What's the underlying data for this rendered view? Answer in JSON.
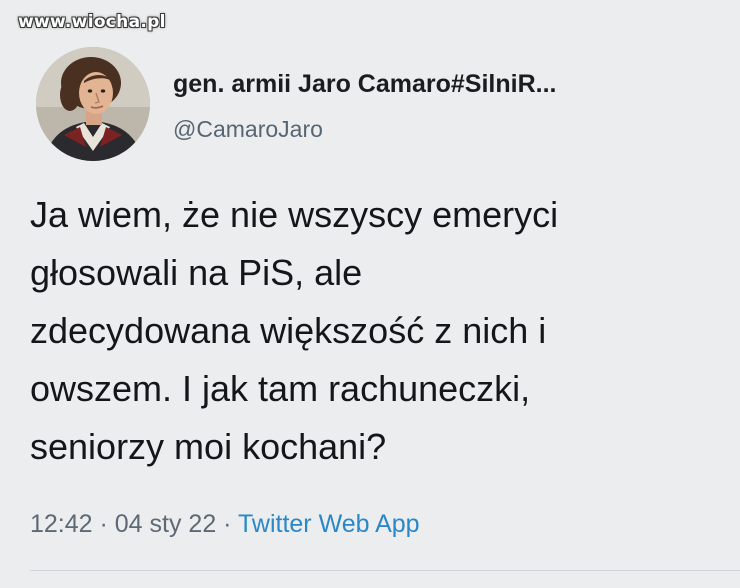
{
  "watermark": "www.wiocha.pl",
  "author": {
    "name": "gen. armii Jaro Camaro#SilniR...",
    "handle": "@CamaroJaro",
    "avatar": "avatar-portrait"
  },
  "tweet": {
    "lines": [
      "Ja wiem, że nie wszyscy emeryci",
      "głosowali na PiS, ale",
      "zdecydowana większość z nich i",
      "owszem. I jak tam rachuneczki,",
      "seniorzy moi kochani?"
    ]
  },
  "meta": {
    "time": "12:42",
    "separator": " · ",
    "date": "04 sty 22",
    "source": "Twitter Web App"
  },
  "colors": {
    "background": "#ecedee",
    "text": "#14171a",
    "muted": "#586673",
    "link": "#2a87c8"
  }
}
